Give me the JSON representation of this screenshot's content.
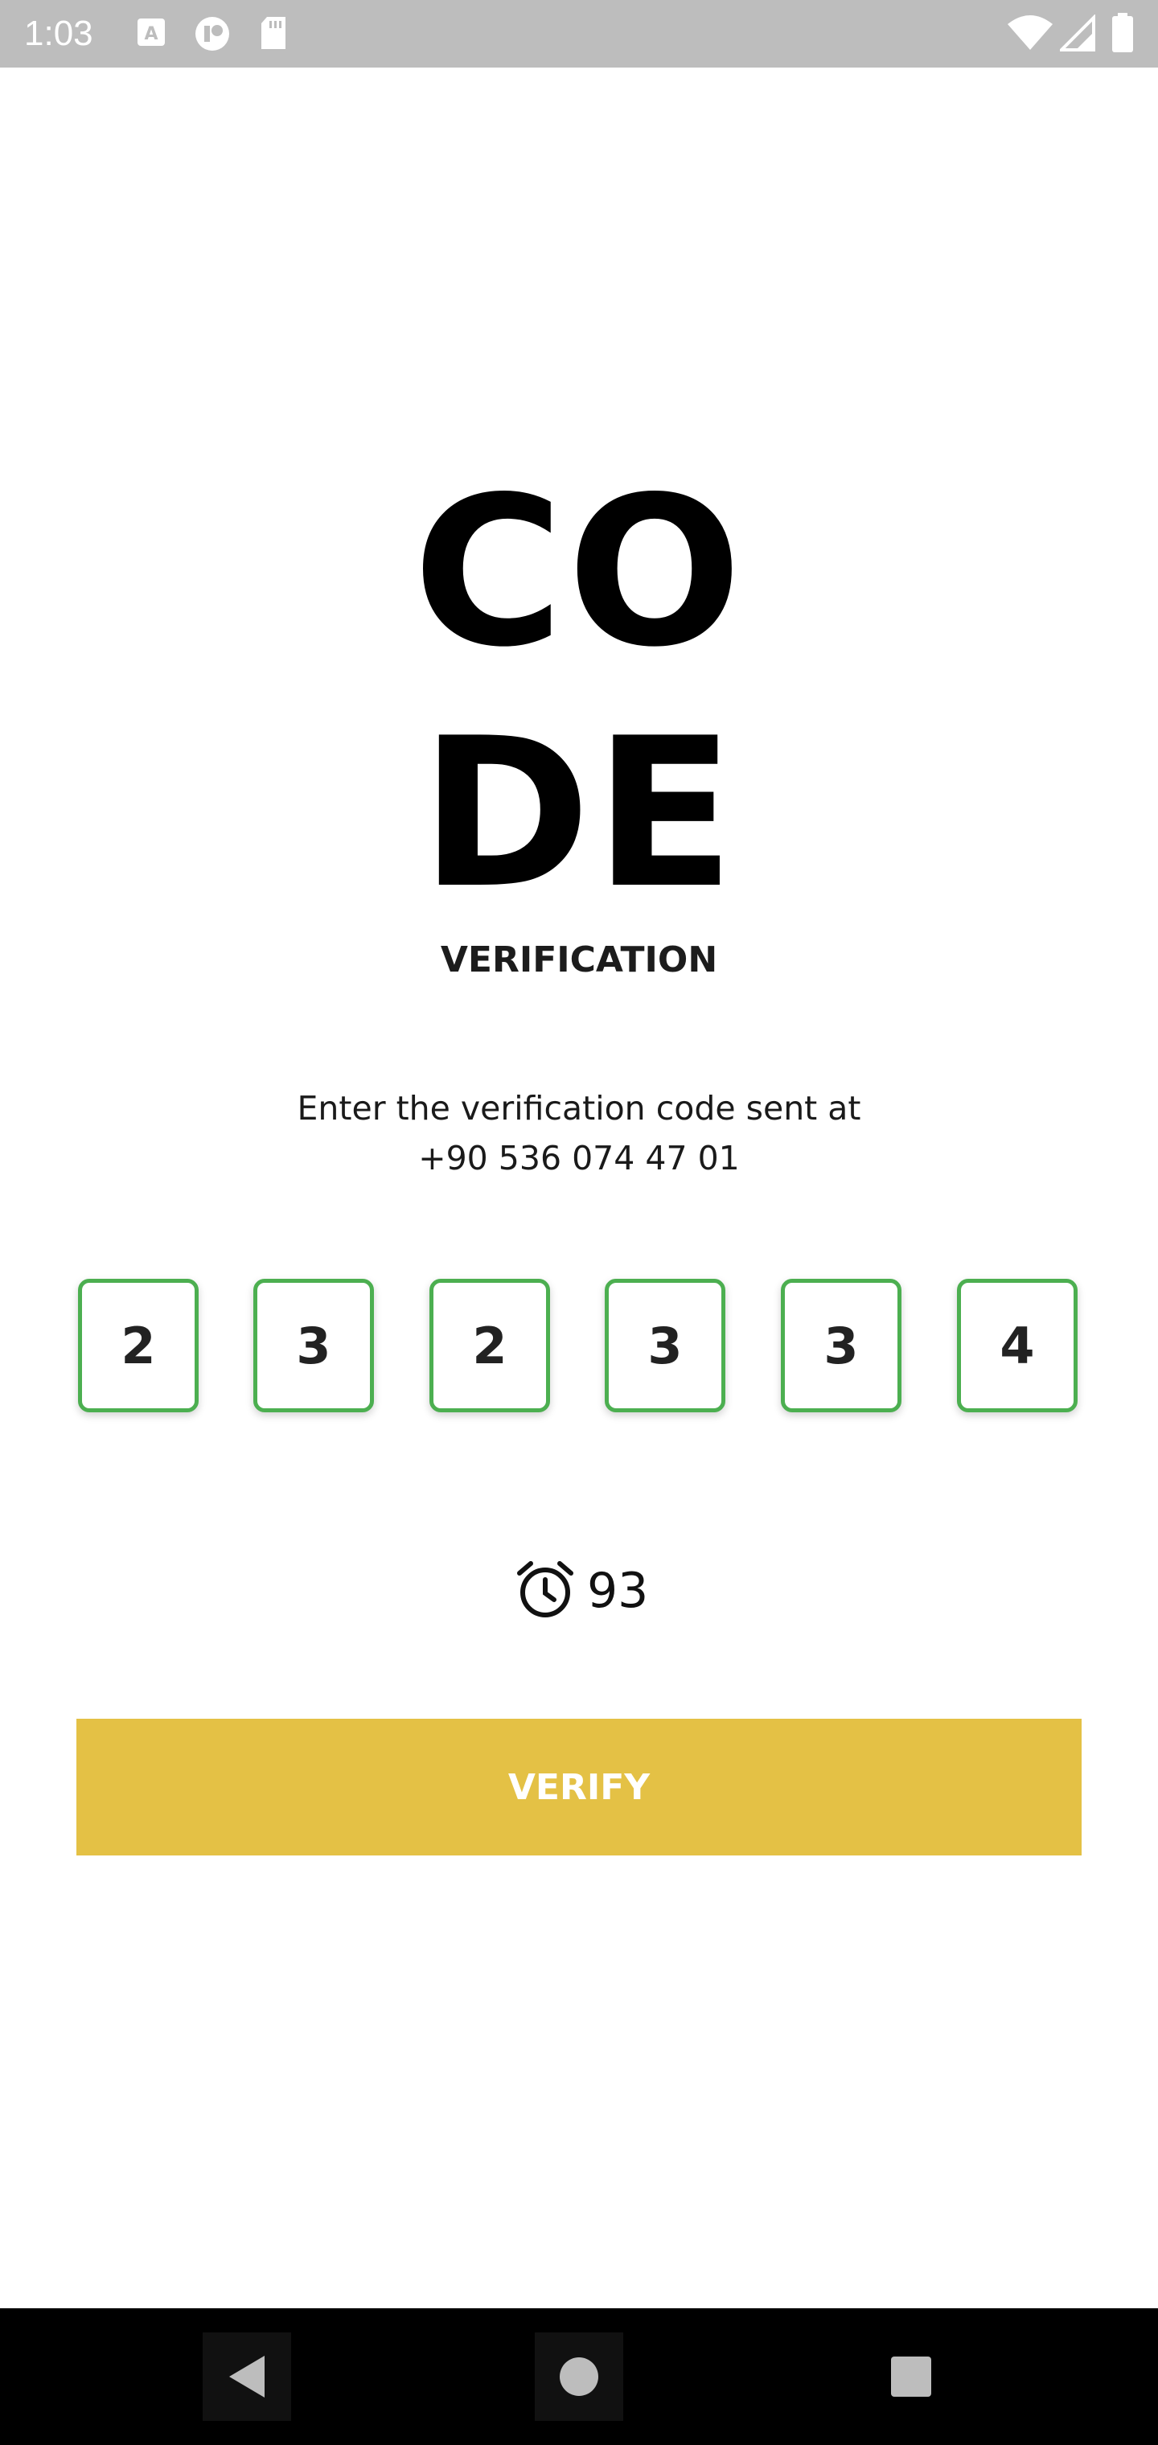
{
  "status_bar": {
    "time": "1:03",
    "icons": [
      "a-icon",
      "notification-app-icon",
      "sd-card-icon",
      "wifi-icon",
      "signal-icon",
      "battery-icon"
    ]
  },
  "header": {
    "title_line1": "CO",
    "title_line2": "DE",
    "subtitle": "VERIFICATION"
  },
  "instruction": {
    "line1": "Enter the verification code sent at",
    "phone": "+90 536 074 47 01"
  },
  "code": {
    "digits": [
      "2",
      "3",
      "2",
      "3",
      "3",
      "4"
    ],
    "border_color": "#4caf50"
  },
  "timer": {
    "icon": "alarm-clock-icon",
    "value": "93"
  },
  "verify_button": {
    "label": "VERIFY",
    "color": "#e4c145"
  },
  "nav_bar": {
    "icons": [
      "back-icon",
      "home-icon",
      "recents-icon"
    ]
  }
}
